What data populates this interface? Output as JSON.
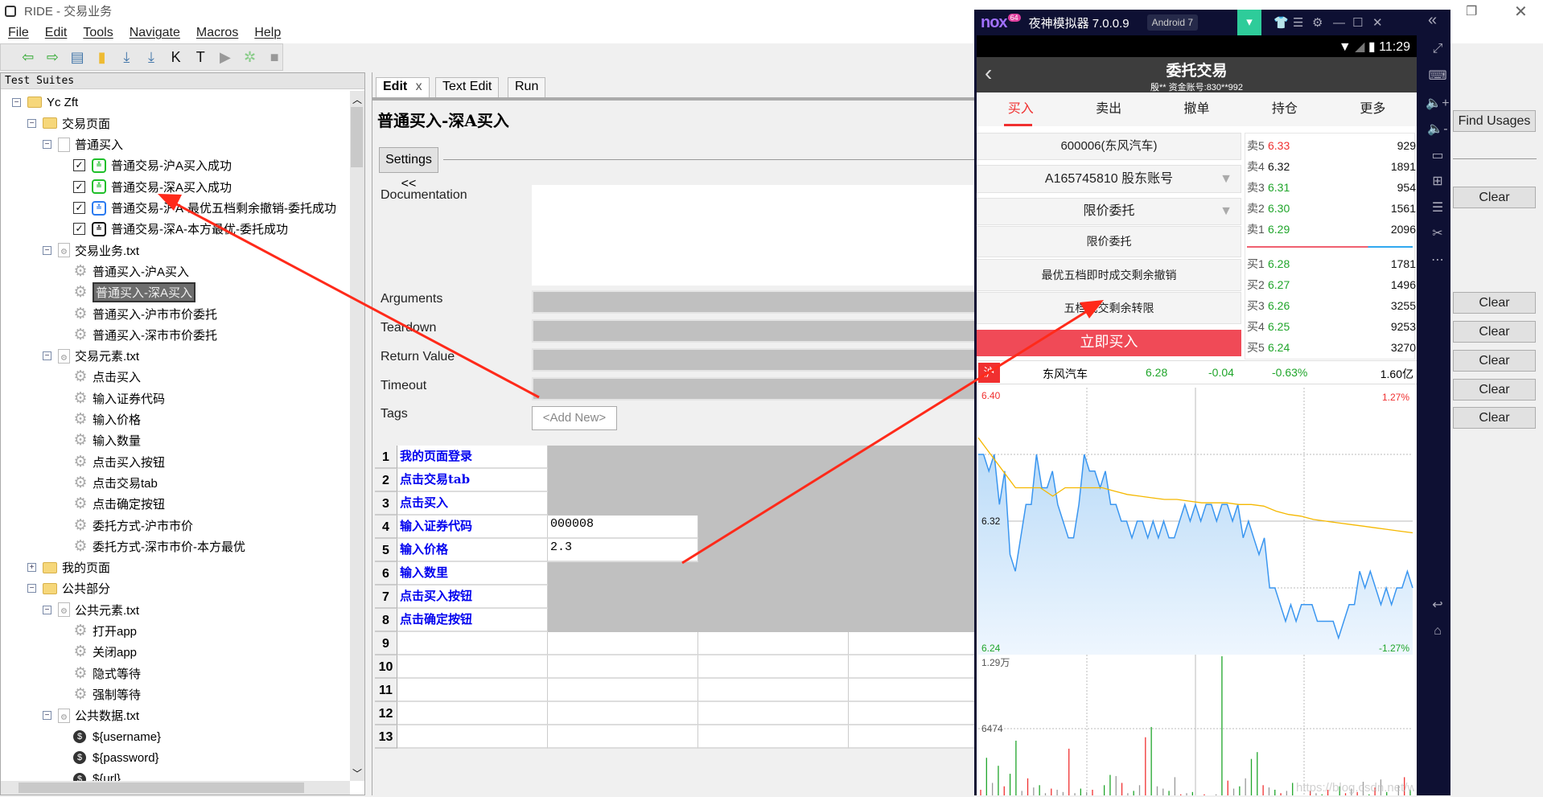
{
  "window": {
    "title": "RIDE - 交易业务",
    "menu": [
      "File",
      "Edit",
      "Tools",
      "Navigate",
      "Macros",
      "Help"
    ]
  },
  "toolbar": {
    "icons": [
      "back-arrow",
      "forward-arrow",
      "open-folder",
      "new-file",
      "save",
      "save-all",
      "search-keywords",
      "search-tests",
      "run",
      "debug",
      "stop"
    ],
    "glyphs": [
      "⇦",
      "⇨",
      "▤",
      "▮",
      "⤓",
      "⤓",
      "K",
      "T",
      "▶",
      "✲",
      "■"
    ]
  },
  "tree": {
    "header": "Test Suites",
    "items": [
      {
        "label": "Yc Zft",
        "depth": 0,
        "type": "folder",
        "exp": "-"
      },
      {
        "label": "交易页面",
        "depth": 1,
        "type": "folder",
        "exp": "-"
      },
      {
        "label": "普通买入",
        "depth": 2,
        "type": "file",
        "exp": "-"
      },
      {
        "label": "普通交易-沪A买入成功",
        "depth": 3,
        "type": "test",
        "robot": "#1fbf2a",
        "checked": true
      },
      {
        "label": "普通交易-深A买入成功",
        "depth": 3,
        "type": "test",
        "robot": "#1fbf2a",
        "checked": true
      },
      {
        "label": "普通交易-沪A-最优五档剩余撤销-委托成功",
        "depth": 3,
        "type": "test",
        "robot": "#2a7af0",
        "checked": true
      },
      {
        "label": "普通交易-深A-本方最优-委托成功",
        "depth": 3,
        "type": "test",
        "robot": "#111111",
        "checked": true
      },
      {
        "label": "交易业务.txt",
        "depth": 2,
        "type": "resource",
        "exp": "-"
      },
      {
        "label": "普通买入-沪A买入",
        "depth": 3,
        "type": "keyword"
      },
      {
        "label": "普通买入-深A买入",
        "depth": 3,
        "type": "keyword",
        "selected": true
      },
      {
        "label": "普通买入-沪市市价委托",
        "depth": 3,
        "type": "keyword"
      },
      {
        "label": "普通买入-深市市价委托",
        "depth": 3,
        "type": "keyword"
      },
      {
        "label": "交易元素.txt",
        "depth": 2,
        "type": "resource",
        "exp": "-"
      },
      {
        "label": "点击买入",
        "depth": 3,
        "type": "keyword"
      },
      {
        "label": "输入证券代码",
        "depth": 3,
        "type": "keyword"
      },
      {
        "label": "输入价格",
        "depth": 3,
        "type": "keyword"
      },
      {
        "label": "输入数量",
        "depth": 3,
        "type": "keyword"
      },
      {
        "label": "点击买入按钮",
        "depth": 3,
        "type": "keyword"
      },
      {
        "label": "点击交易tab",
        "depth": 3,
        "type": "keyword"
      },
      {
        "label": "点击确定按钮",
        "depth": 3,
        "type": "keyword"
      },
      {
        "label": "委托方式-沪市市价",
        "depth": 3,
        "type": "keyword"
      },
      {
        "label": "委托方式-深市市价-本方最优",
        "depth": 3,
        "type": "keyword"
      },
      {
        "label": "我的页面",
        "depth": 1,
        "type": "folder",
        "exp": "+"
      },
      {
        "label": "公共部分",
        "depth": 1,
        "type": "folder",
        "exp": "-"
      },
      {
        "label": "公共元素.txt",
        "depth": 2,
        "type": "resource",
        "exp": "-"
      },
      {
        "label": "打开app",
        "depth": 3,
        "type": "keyword"
      },
      {
        "label": "关闭app",
        "depth": 3,
        "type": "keyword"
      },
      {
        "label": "隐式等待",
        "depth": 3,
        "type": "keyword"
      },
      {
        "label": "强制等待",
        "depth": 3,
        "type": "keyword"
      },
      {
        "label": "公共数据.txt",
        "depth": 2,
        "type": "resource",
        "exp": "-"
      },
      {
        "label": "${username}",
        "depth": 3,
        "type": "variable"
      },
      {
        "label": "${password}",
        "depth": 3,
        "type": "variable"
      },
      {
        "label": "${url}",
        "depth": 3,
        "type": "variable"
      }
    ]
  },
  "editor": {
    "tabs": [
      "Edit",
      "Text Edit",
      "Run"
    ],
    "title": "普通买入-深A买入",
    "settings_button": "Settings <<",
    "labels": {
      "documentation": "Documentation",
      "arguments": "Arguments",
      "teardown": "Teardown",
      "return_value": "Return Value",
      "timeout": "Timeout",
      "tags": "Tags"
    },
    "tags_add": "<Add New>",
    "rows": [
      {
        "n": "1",
        "cells": [
          "我的页面登录"
        ]
      },
      {
        "n": "2",
        "cells": [
          "点击交易tab"
        ]
      },
      {
        "n": "3",
        "cells": [
          "点击买入"
        ]
      },
      {
        "n": "4",
        "cells": [
          "输入证券代码",
          "000008"
        ]
      },
      {
        "n": "5",
        "cells": [
          "输入价格",
          "2.3"
        ]
      },
      {
        "n": "6",
        "cells": [
          "输入数里"
        ]
      },
      {
        "n": "7",
        "cells": [
          "点击买入按钮"
        ]
      },
      {
        "n": "8",
        "cells": [
          "点击确定按钮"
        ]
      },
      {
        "n": "9",
        "cells": []
      },
      {
        "n": "10",
        "cells": []
      },
      {
        "n": "11",
        "cells": []
      },
      {
        "n": "12",
        "cells": []
      },
      {
        "n": "13",
        "cells": []
      }
    ]
  },
  "right_panel": {
    "find_usages": "Find Usages",
    "clear_buttons": [
      "Clear",
      "Clear",
      "Clear",
      "Clear",
      "Clear",
      "Clear"
    ]
  },
  "nox": {
    "brand": "nox",
    "badge": "64",
    "title": "夜神模拟器 7.0.0.9",
    "android": "Android 7",
    "time": "11:29",
    "side_icons": [
      "fullscreen-icon",
      "keyboard-icon",
      "volume-up-icon",
      "volume-down-icon",
      "screen-icon",
      "apk-install-icon",
      "multi-instance-icon",
      "scissors-icon",
      "more-icon",
      "back-icon",
      "home-icon"
    ],
    "side_glyphs": [
      "⤢",
      "⌨",
      "🔈+",
      "🔈-",
      "▭",
      "⊞",
      "☰",
      "✂",
      "⋯",
      "↩",
      "⌂"
    ]
  },
  "app": {
    "header_title": "委托交易",
    "header_sub": "殷**  资金账号:830**992",
    "tabs": [
      "买入",
      "卖出",
      "撤单",
      "持仓",
      "更多"
    ],
    "stock": "600006(东风汽车)",
    "account": "A165745810 股东账号",
    "order_type": "限价委托",
    "order_options": [
      "限价委托",
      "最优五档即时成交剩余撤销",
      "五档成交剩余转限"
    ],
    "buy_button": "立即买入",
    "asks": [
      {
        "n": "卖5",
        "p": "6.33",
        "q": "929",
        "c": "#f03030"
      },
      {
        "n": "卖4",
        "p": "6.32",
        "q": "1891",
        "c": "#111111"
      },
      {
        "n": "卖3",
        "p": "6.31",
        "q": "954",
        "c": "#1fa52a"
      },
      {
        "n": "卖2",
        "p": "6.30",
        "q": "1561",
        "c": "#1fa52a"
      },
      {
        "n": "卖1",
        "p": "6.29",
        "q": "2096",
        "c": "#1fa52a"
      }
    ],
    "bids": [
      {
        "n": "买1",
        "p": "6.28",
        "q": "1781",
        "c": "#1fa52a"
      },
      {
        "n": "买2",
        "p": "6.27",
        "q": "1496",
        "c": "#1fa52a"
      },
      {
        "n": "买3",
        "p": "6.26",
        "q": "3255",
        "c": "#1fa52a"
      },
      {
        "n": "买4",
        "p": "6.25",
        "q": "9253",
        "c": "#1fa52a"
      },
      {
        "n": "买5",
        "p": "6.24",
        "q": "3270",
        "c": "#1fa52a"
      }
    ],
    "quote": {
      "market": "沪",
      "name": "东风汽车",
      "price": "6.28",
      "change": "-0.04",
      "pct": "-0.63%",
      "amount": "1.60亿"
    },
    "colors": {
      "up": "#f03030",
      "down": "#1fa52a",
      "accent": "#f04a57",
      "nox_green": "#2ecc9a"
    }
  },
  "chart_data": {
    "type": "line",
    "price_labels": {
      "top": "6.40",
      "mid": "6.32",
      "bottom": "6.24",
      "top_pct": "1.27%",
      "bottom_pct": "-1.27%"
    },
    "ylim": [
      6.24,
      6.4
    ],
    "price": [
      6.36,
      6.36,
      6.35,
      6.36,
      6.33,
      6.35,
      6.3,
      6.29,
      6.31,
      6.33,
      6.33,
      6.36,
      6.34,
      6.34,
      6.35,
      6.33,
      6.32,
      6.31,
      6.31,
      6.33,
      6.36,
      6.35,
      6.35,
      6.34,
      6.35,
      6.33,
      6.33,
      6.32,
      6.32,
      6.31,
      6.32,
      6.32,
      6.31,
      6.32,
      6.31,
      6.32,
      6.31,
      6.31,
      6.32,
      6.33,
      6.32,
      6.33,
      6.32,
      6.33,
      6.33,
      6.32,
      6.33,
      6.33,
      6.32,
      6.33,
      6.31,
      6.32,
      6.31,
      6.3,
      6.31,
      6.28,
      6.28,
      6.27,
      6.26,
      6.27,
      6.26,
      6.27,
      6.27,
      6.27,
      6.26,
      6.26,
      6.26,
      6.26,
      6.25,
      6.26,
      6.27,
      6.27,
      6.29,
      6.28,
      6.29,
      6.28,
      6.27,
      6.28,
      6.27,
      6.28,
      6.28,
      6.29,
      6.28
    ],
    "avg": [
      6.37,
      6.36,
      6.35,
      6.34,
      6.34,
      6.34,
      6.335,
      6.34,
      6.34,
      6.34,
      6.34,
      6.338,
      6.336,
      6.335,
      6.334,
      6.333,
      6.333,
      6.332,
      6.331,
      6.331,
      6.331,
      6.33,
      6.33,
      6.329,
      6.326,
      6.324,
      6.323,
      6.321,
      6.32,
      6.319,
      6.318,
      6.317,
      6.316,
      6.315,
      6.314,
      6.313
    ],
    "volume_labels": {
      "max": "1.29万",
      "mid": "6474"
    },
    "volume_max": 12900,
    "volume": [
      1200,
      4000,
      1800,
      3300,
      1500,
      2600,
      5500,
      1100,
      2200,
      1400,
      1600,
      900,
      1300,
      1200,
      1000,
      4800,
      900,
      1300,
      1000,
      1200,
      700,
      1600,
      2500,
      2400,
      1800,
      900,
      1100,
      1600,
      5800,
      6700,
      1500,
      1300,
      1100,
      2300,
      800,
      900,
      1000,
      400,
      800,
      600,
      800,
      12900,
      2000,
      1300,
      1500,
      2200,
      3900,
      4500,
      1600,
      1400,
      1200,
      900,
      1100,
      1800,
      700,
      600,
      1100,
      900,
      800,
      1200,
      700,
      1500,
      900,
      1300,
      1000,
      1900,
      800,
      1400,
      2100,
      1000,
      600,
      1600,
      2300,
      1200
    ],
    "volume_dir": [
      "u",
      "d",
      "f",
      "d",
      "u",
      "d",
      "d",
      "f",
      "u",
      "f",
      "d",
      "f",
      "u",
      "f",
      "f",
      "u",
      "f",
      "d",
      "f",
      "u",
      "f",
      "d",
      "d",
      "f",
      "u",
      "f",
      "d",
      "f",
      "u",
      "d",
      "f",
      "f",
      "d",
      "f",
      "u",
      "f",
      "d",
      "f",
      "u",
      "d",
      "f",
      "d",
      "u",
      "f",
      "d",
      "f",
      "d",
      "d",
      "u",
      "f",
      "d",
      "u",
      "f",
      "d",
      "u",
      "f",
      "u",
      "f",
      "d",
      "u",
      "f",
      "d",
      "u",
      "f",
      "u",
      "f",
      "d",
      "u",
      "f",
      "d",
      "u",
      "f",
      "u",
      "d"
    ],
    "watermark": "https://blog.csdn.net/weixin_45230919"
  }
}
